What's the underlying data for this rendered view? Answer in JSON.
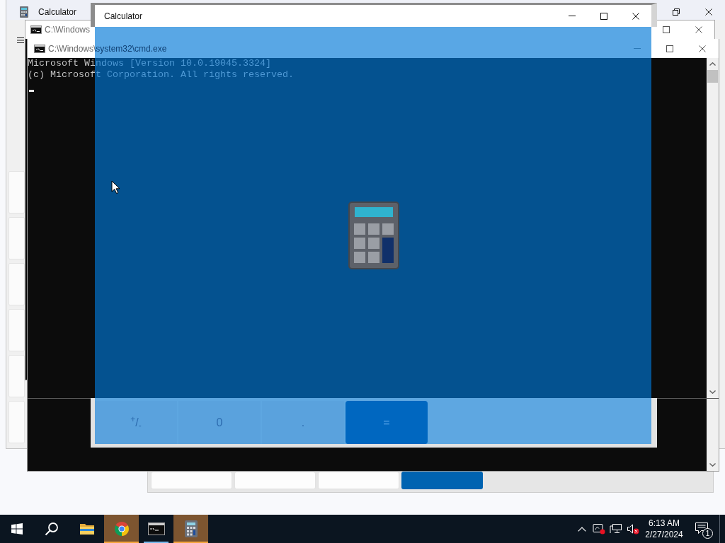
{
  "back_calculator": {
    "title": "Calculator"
  },
  "back_console": {
    "title": "C:\\Windows"
  },
  "lower_calculator": {
    "keys": [
      {
        "kind": "plain"
      },
      {
        "kind": "plain"
      },
      {
        "kind": "plain"
      },
      {
        "kind": "accent"
      }
    ]
  },
  "console": {
    "title": "C:\\Windows\\system32\\cmd.exe",
    "lines": [
      "Microsoft Windows [Version 10.0.19045.3324]",
      "(c) Microsoft Corporation. All rights reserved."
    ]
  },
  "calculator": {
    "title": "Calculator",
    "keys": [
      {
        "label": "$^{+}$/$_{-}$",
        "kind": "plain"
      },
      {
        "label": "0",
        "kind": "plain"
      },
      {
        "label": ".",
        "kind": "plain"
      },
      {
        "label": "=",
        "kind": "accent"
      }
    ]
  },
  "taskbar": {
    "apps": [
      {
        "running": false,
        "flashing": false
      },
      {
        "running": true,
        "flashing": true
      },
      {
        "running": true,
        "flashing": false
      },
      {
        "running": true,
        "flashing": true
      }
    ],
    "volume_muted": true,
    "time": "6:13 AM",
    "date": "2/27/2024",
    "notification_count": "1"
  }
}
